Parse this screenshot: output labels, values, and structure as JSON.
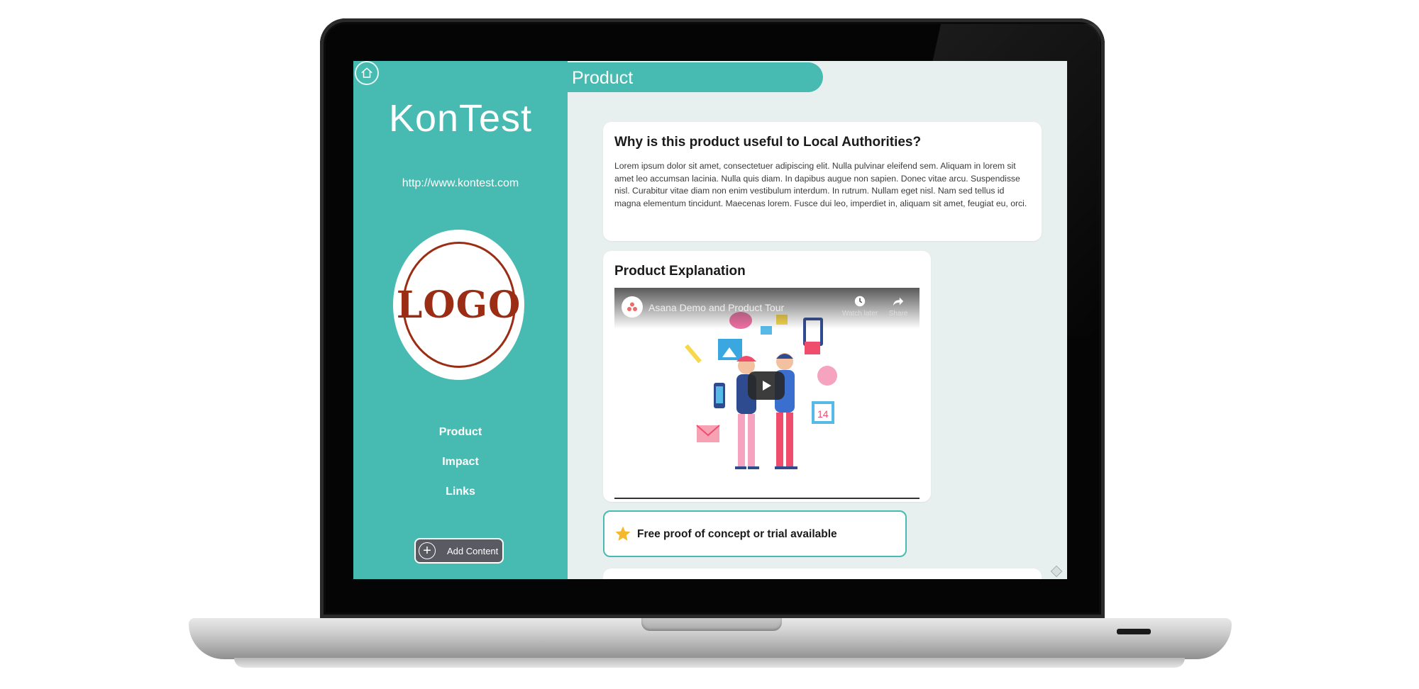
{
  "sidebar": {
    "brand": "KonTest",
    "url": "http://www.kontest.com",
    "logo_text": "LOGO",
    "nav": [
      "Product",
      "Impact",
      "Links"
    ],
    "add_button": "Add Content"
  },
  "header": {
    "title": "Product"
  },
  "cards": {
    "why": {
      "title": "Why is this product useful to Local Authorities?",
      "body": "Lorem ipsum dolor sit amet, consectetuer adipiscing elit. Nulla pulvinar eleifend sem. Aliquam in lorem sit amet leo accumsan lacinia. Nulla quis diam. In dapibus augue non sapien. Donec vitae arcu. Suspendisse nisl. Curabitur vitae diam non enim vestibulum interdum. In rutrum. Nullam eget nisl. Nam sed tellus id magna elementum tincidunt. Maecenas lorem. Fusce dui leo, imperdiet in, aliquam sit amet, feugiat eu, orci."
    },
    "explanation": {
      "title": "Product Explanation",
      "video": {
        "title": "Asana Demo and Product Tour",
        "watch_later": "Watch later",
        "share": "Share",
        "calendar_number": "14"
      }
    },
    "trial": {
      "text": "Free proof of concept or trial available"
    }
  },
  "colors": {
    "accent": "#47bab1",
    "background": "#e8f0ef",
    "logo": "#9a2d14",
    "button": "#595a62"
  },
  "icons": [
    "home-icon",
    "plus-circle-icon",
    "star-icon",
    "clock-icon",
    "share-icon",
    "play-icon",
    "asana-logo-icon",
    "edit-icon"
  ]
}
